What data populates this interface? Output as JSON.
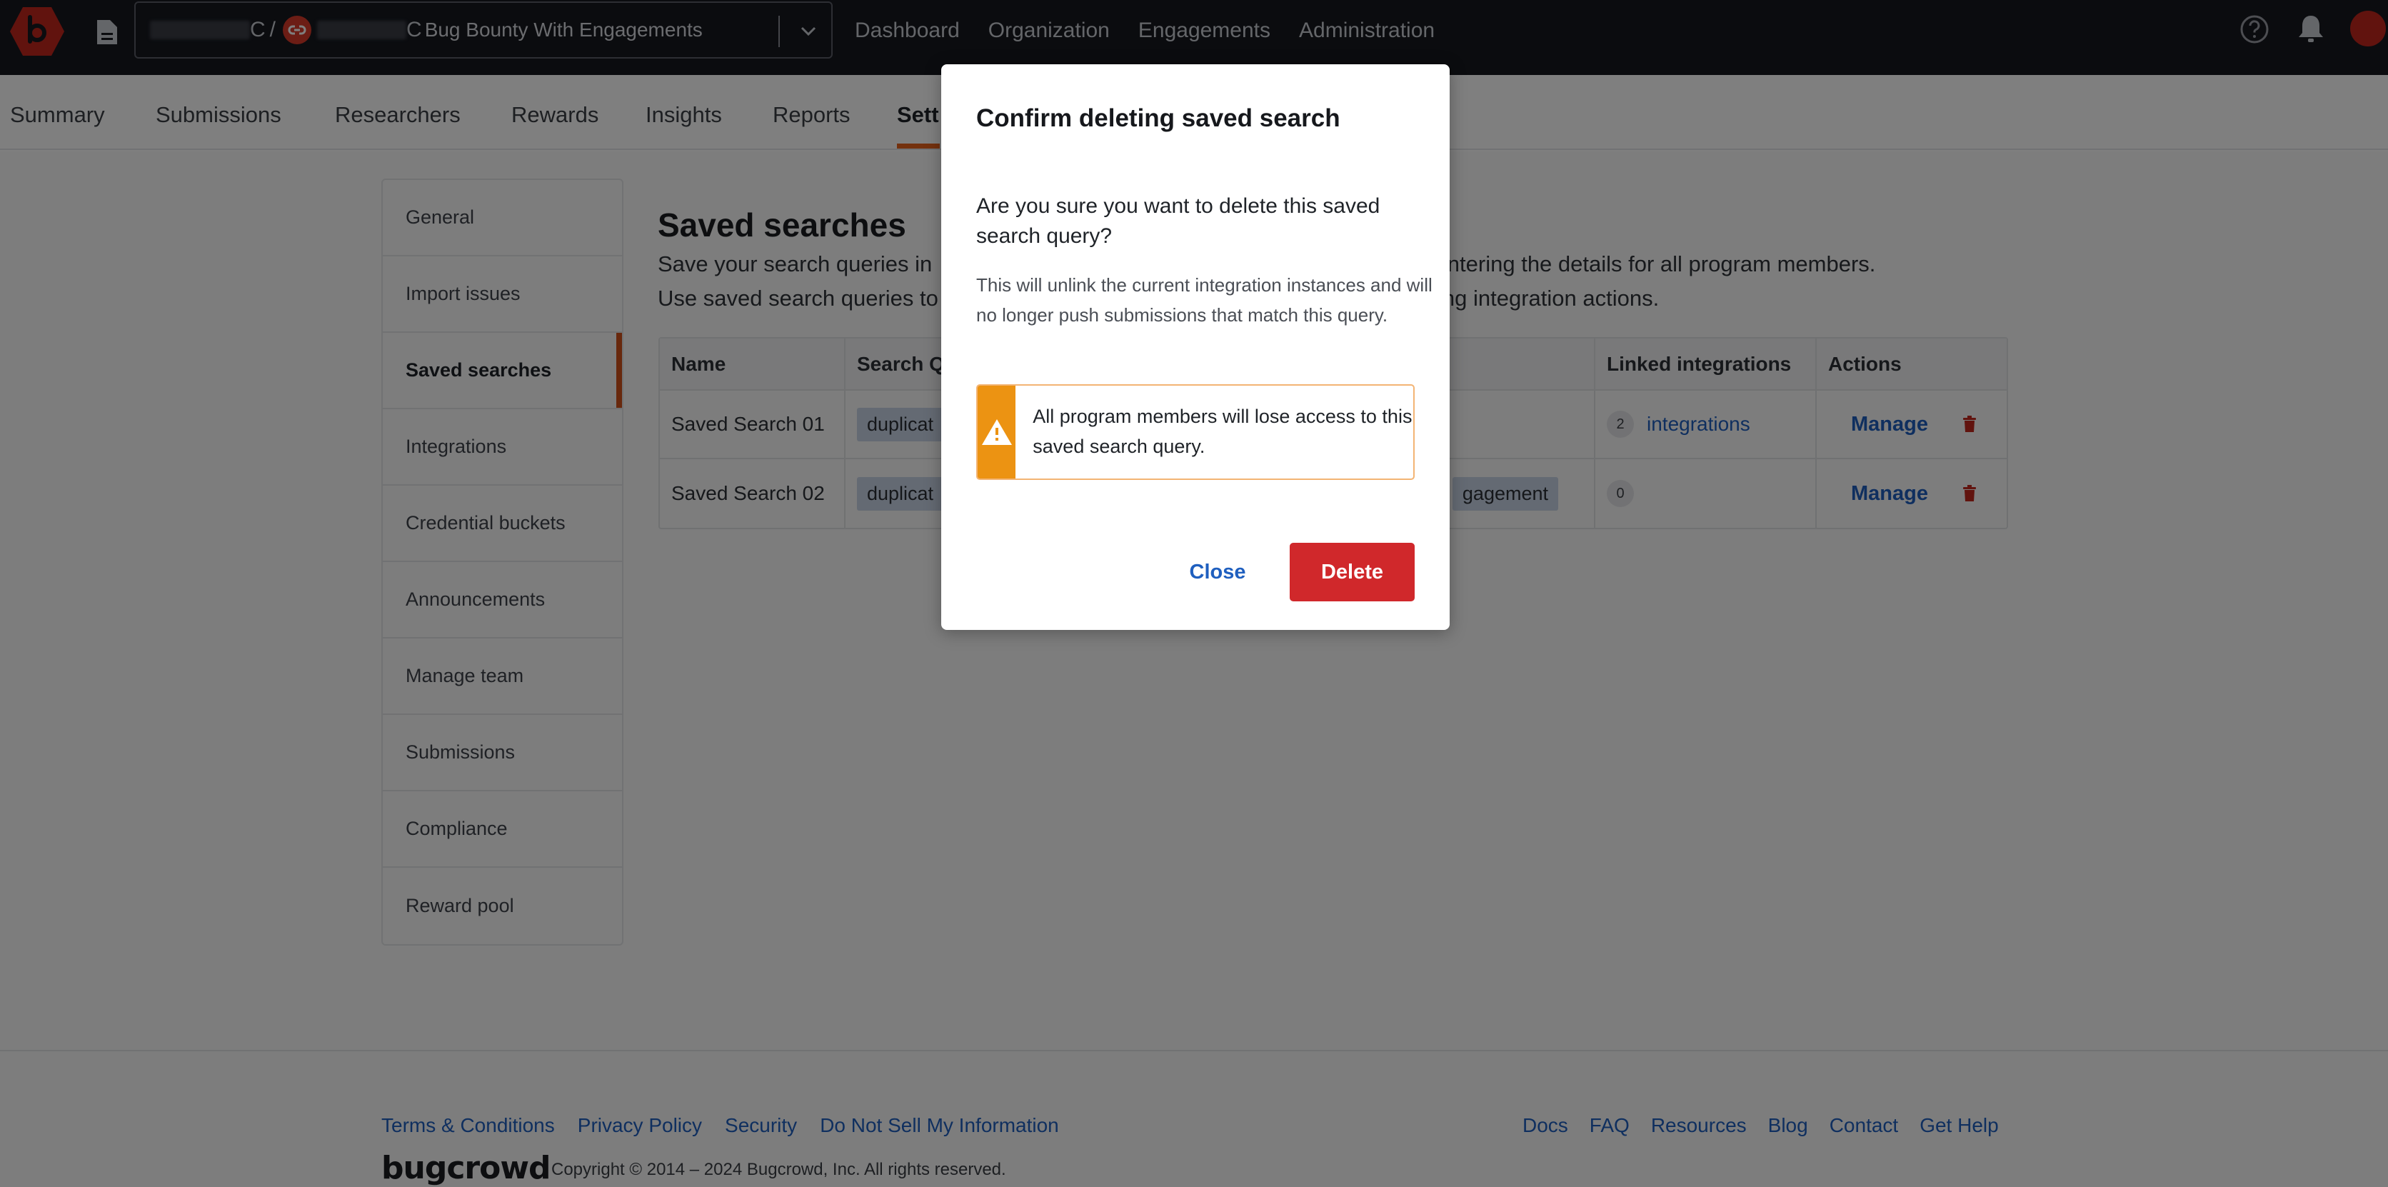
{
  "topnav": {
    "program_selector": {
      "separator": "/",
      "trailing_char": "C",
      "program_name": "Bug Bounty With Engagements"
    },
    "links": [
      "Dashboard",
      "Organization",
      "Engagements",
      "Administration"
    ],
    "icons": {
      "logo": "bugcrowd-logo",
      "doc": "document-icon",
      "engagement": "link-icon",
      "chevron": "chevron-down-icon",
      "help": "help-circle-icon",
      "bell": "bell-icon",
      "avatar": "avatar"
    }
  },
  "subnav": {
    "tabs": [
      {
        "label": "Summary",
        "active": false
      },
      {
        "label": "Submissions",
        "active": false
      },
      {
        "label": "Researchers",
        "active": false
      },
      {
        "label": "Rewards",
        "active": false
      },
      {
        "label": "Insights",
        "active": false
      },
      {
        "label": "Reports",
        "active": false
      },
      {
        "label": "Sett",
        "active": true
      }
    ]
  },
  "sidebar": {
    "items": [
      {
        "label": "General",
        "active": false
      },
      {
        "label": "Import issues",
        "active": false
      },
      {
        "label": "Saved searches",
        "active": true
      },
      {
        "label": "Integrations",
        "active": false
      },
      {
        "label": "Credential buckets",
        "active": false
      },
      {
        "label": "Announcements",
        "active": false
      },
      {
        "label": "Manage team",
        "active": false
      },
      {
        "label": "Submissions",
        "active": false
      },
      {
        "label": "Compliance",
        "active": false
      },
      {
        "label": "Reward pool",
        "active": false
      }
    ]
  },
  "main": {
    "title": "Saved searches",
    "description_line1": "Save your search queries in",
    "description_line1_end": "e-entering the details for all program members.",
    "description_line2": "Use saved search queries to",
    "description_line2_end": "ing integration actions.",
    "table": {
      "columns": [
        "Name",
        "Search Q",
        "Linked integrations",
        "Actions"
      ],
      "rows": [
        {
          "name": "Saved Search 01",
          "query_chip_start": "duplicat",
          "query_chip_end": "",
          "linked_count": "2",
          "linked_label": "integrations",
          "manage": "Manage"
        },
        {
          "name": "Saved Search 02",
          "query_chip_start": "duplicat",
          "query_chip_end": "gagement",
          "linked_count": "0",
          "linked_label": "",
          "manage": "Manage"
        }
      ]
    }
  },
  "footer": {
    "left_links": [
      "Terms & Conditions",
      "Privacy Policy",
      "Security",
      "Do Not Sell My Information"
    ],
    "right_links": [
      "Docs",
      "FAQ",
      "Resources",
      "Blog",
      "Contact",
      "Get Help"
    ],
    "brand": "bugcrowd",
    "copyright": "Copyright © 2014 – 2024 Bugcrowd, Inc. All rights reserved."
  },
  "modal": {
    "title": "Confirm deleting saved search",
    "question": "Are you sure you want to delete this saved search query?",
    "detail": "This will unlink the current integration instances and will no longer push submissions that match this query.",
    "warning": "All program members will lose access to this saved search query.",
    "close_label": "Close",
    "delete_label": "Delete"
  },
  "colors": {
    "accent": "#e8621d",
    "link": "#1f5fbf",
    "danger": "#d0282b",
    "warning": "#ec9312",
    "topnav_bg": "#16181f"
  }
}
